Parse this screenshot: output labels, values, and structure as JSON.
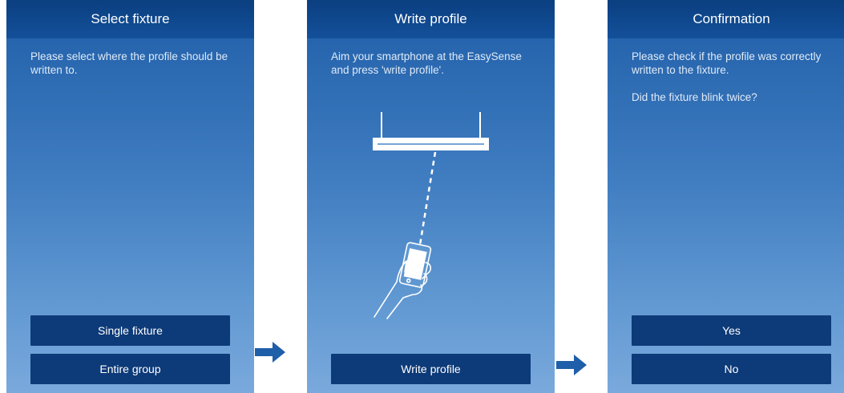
{
  "screens": [
    {
      "title": "Select fixture",
      "lines": [
        "Please select where the profile should be written to."
      ],
      "buttons": [
        "Single fixture",
        "Entire group"
      ]
    },
    {
      "title": "Write profile",
      "lines": [
        "Aim your smartphone at the EasySense and press 'write profile'."
      ],
      "buttons": [
        "Write profile"
      ]
    },
    {
      "title": "Confirmation",
      "lines": [
        "Please check if the profile was correctly written to the fixture.",
        "Did the fixture blink twice?"
      ],
      "buttons": [
        "Yes",
        "No"
      ]
    }
  ],
  "colors": {
    "header": "#0b3f80",
    "button": "#0d3a78",
    "arrow": "#1f5ea8"
  },
  "icons": [
    "fixture-icon",
    "hand-holding-phone-icon",
    "arrow-right-icon"
  ]
}
